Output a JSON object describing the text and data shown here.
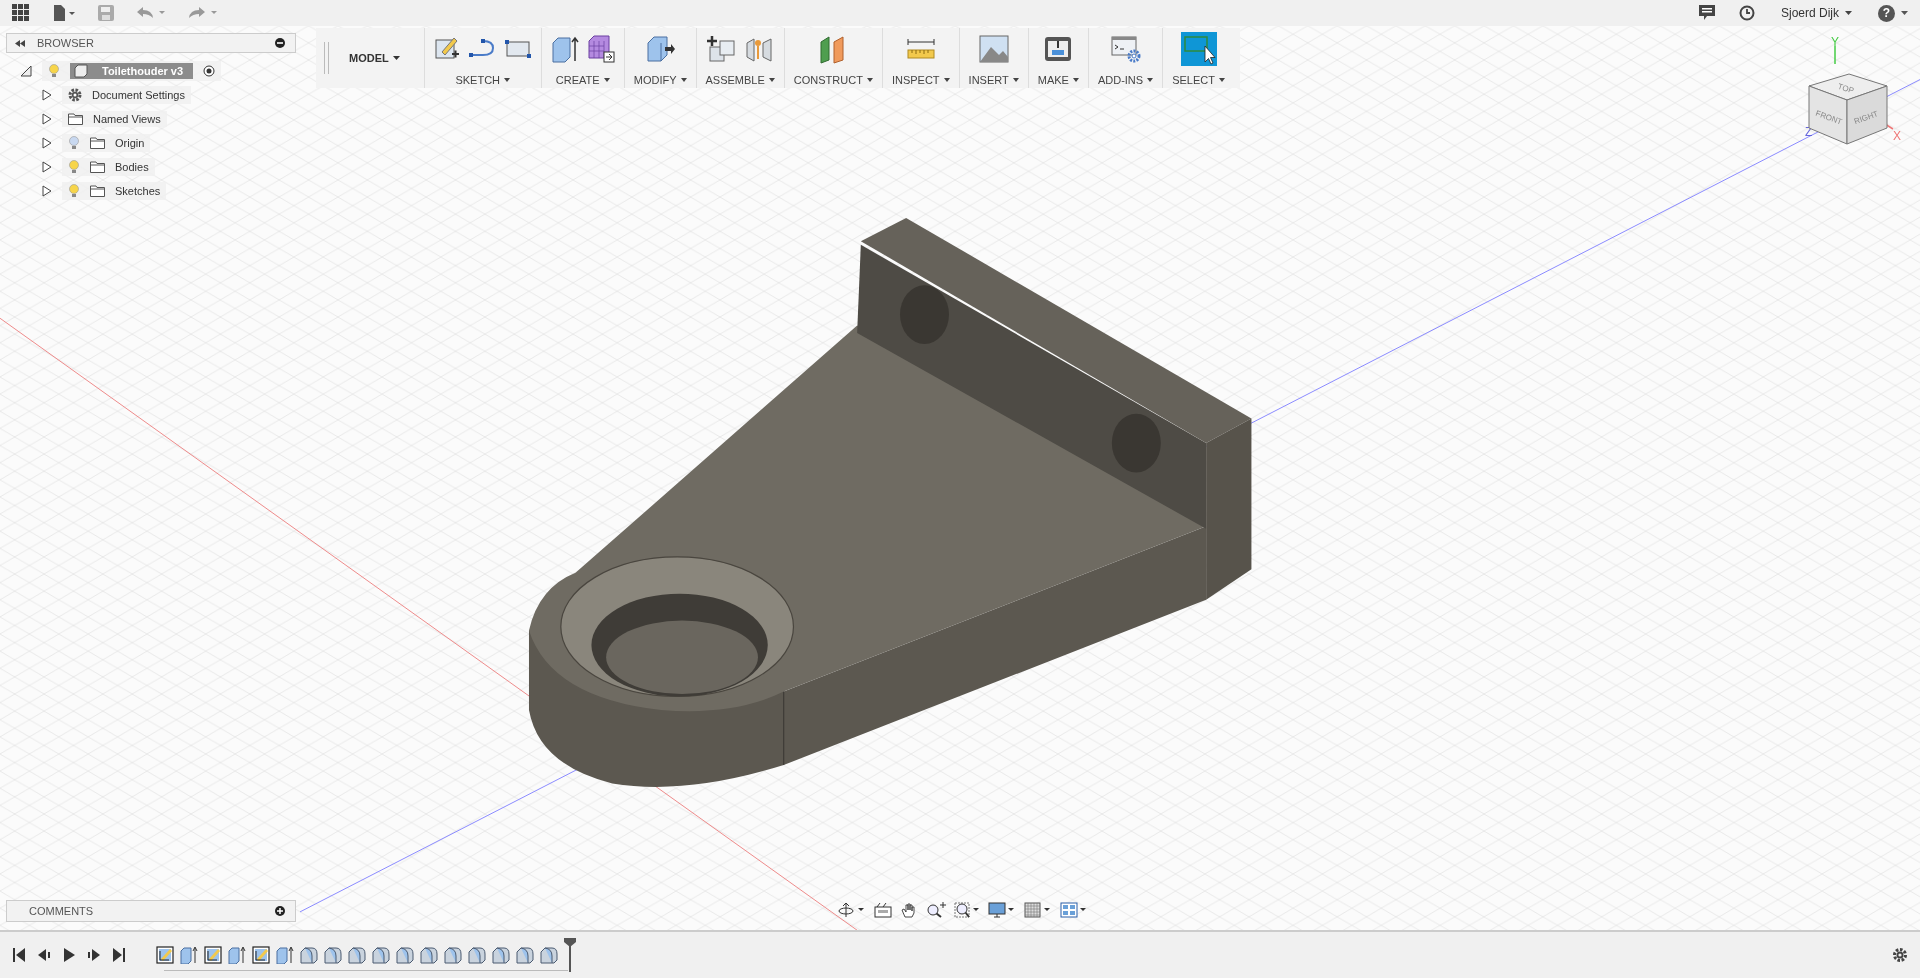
{
  "top_bar": {
    "user": "Sjoerd Dijk",
    "help": "?"
  },
  "browser": {
    "title": "BROWSER",
    "root": {
      "label": "Toilethouder v3",
      "expanded": true,
      "visible": true,
      "children": [
        {
          "label": "Document Settings",
          "kind": "settings",
          "expanded": false
        },
        {
          "label": "Named Views",
          "kind": "folder",
          "expanded": false
        },
        {
          "label": "Origin",
          "kind": "folder",
          "expanded": false,
          "visible": false
        },
        {
          "label": "Bodies",
          "kind": "folder",
          "expanded": false,
          "visible": true
        },
        {
          "label": "Sketches",
          "kind": "folder",
          "expanded": false,
          "visible": true
        }
      ]
    }
  },
  "toolbar": {
    "workspace": "MODEL",
    "groups": [
      {
        "label": "SKETCH"
      },
      {
        "label": "CREATE"
      },
      {
        "label": "MODIFY"
      },
      {
        "label": "ASSEMBLE"
      },
      {
        "label": "CONSTRUCT"
      },
      {
        "label": "INSPECT"
      },
      {
        "label": "INSERT"
      },
      {
        "label": "MAKE"
      },
      {
        "label": "ADD-INS"
      },
      {
        "label": "SELECT"
      }
    ]
  },
  "view_cube": {
    "faces": [
      "TOP",
      "FRONT",
      "RIGHT"
    ],
    "axes": [
      "X",
      "Y",
      "Z"
    ]
  },
  "comments": {
    "title": "COMMENTS"
  },
  "timeline": {
    "items": [
      {
        "kind": "sketch"
      },
      {
        "kind": "extrude"
      },
      {
        "kind": "sketch"
      },
      {
        "kind": "extrude"
      },
      {
        "kind": "sketch"
      },
      {
        "kind": "extrude"
      },
      {
        "kind": "fillet"
      },
      {
        "kind": "fillet"
      },
      {
        "kind": "fillet"
      },
      {
        "kind": "fillet"
      },
      {
        "kind": "fillet"
      },
      {
        "kind": "fillet"
      },
      {
        "kind": "fillet"
      },
      {
        "kind": "fillet"
      },
      {
        "kind": "fillet"
      },
      {
        "kind": "fillet"
      },
      {
        "kind": "fillet"
      }
    ]
  }
}
